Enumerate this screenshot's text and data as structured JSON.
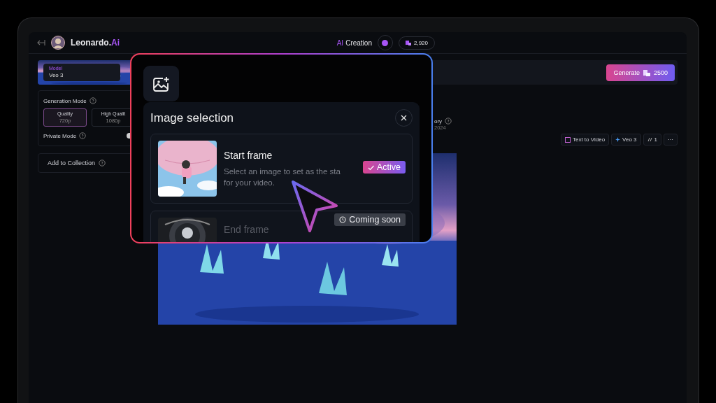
{
  "topbar": {
    "logo_text": "Leonardo.",
    "logo_accent": "Ai",
    "mode_accent": "AI",
    "mode_label": "Creation",
    "credits": "2,920"
  },
  "header": {
    "model_label": "Model",
    "model_value": "Veo 3",
    "generate_label": "Generate",
    "generate_cost": "2500"
  },
  "settings": {
    "generation_mode_label": "Generation Mode",
    "modes": [
      {
        "label": "Quality",
        "detail": "720p",
        "selected": true
      },
      {
        "label": "High Qualit",
        "detail": "1080p",
        "selected": false
      }
    ],
    "private_mode_label": "Private Mode",
    "private_mode_on": false,
    "add_to_collection": "Add to Collection"
  },
  "main": {
    "history_title": "ory",
    "history_date": "2024",
    "chips": [
      {
        "kind": "type",
        "label": "Text to Video"
      },
      {
        "kind": "model",
        "label": "Veo 3"
      },
      {
        "kind": "count",
        "label": "1"
      },
      {
        "kind": "more",
        "label": "⋯"
      }
    ]
  },
  "modal": {
    "title": "Image selection",
    "frames": [
      {
        "title": "Start frame",
        "description": "Select an image to set as the sta",
        "description_2": "for your video.",
        "badge": {
          "kind": "active",
          "label": "Active"
        },
        "disabled": false
      },
      {
        "title": "End frame",
        "badge": {
          "kind": "coming_soon",
          "label": "Coming soon"
        },
        "disabled": true
      }
    ]
  }
}
